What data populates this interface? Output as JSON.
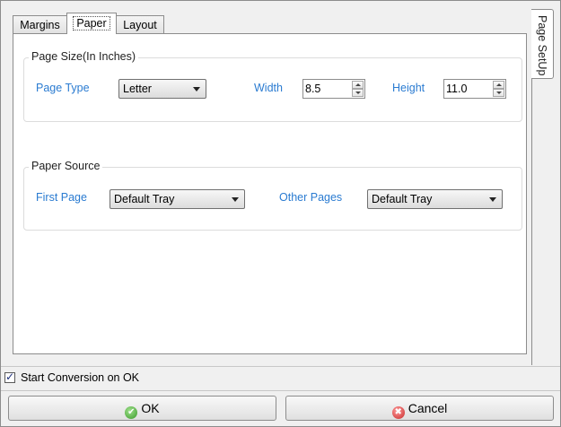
{
  "tabs": [
    {
      "label": "Margins",
      "active": false
    },
    {
      "label": "Paper",
      "active": true
    },
    {
      "label": "Layout",
      "active": false
    }
  ],
  "side_tab": {
    "label": "Page SetUp"
  },
  "page_size": {
    "title": "Page Size(In Inches)",
    "page_type_label": "Page Type",
    "page_type_value": "Letter",
    "width_label": "Width",
    "width_value": "8.5",
    "height_label": "Height",
    "height_value": "11.0"
  },
  "paper_source": {
    "title": "Paper Source",
    "first_page_label": "First Page",
    "first_page_value": "Default Tray",
    "other_pages_label": "Other Pages",
    "other_pages_value": "Default Tray"
  },
  "start_conversion": {
    "label": "Start Conversion on OK",
    "checked": true,
    "check_glyph": "✓"
  },
  "buttons": {
    "ok_label": "OK",
    "ok_glyph": "✔",
    "cancel_label": "Cancel",
    "cancel_glyph": "✖"
  },
  "colors": {
    "label_blue": "#2a7bd1"
  }
}
